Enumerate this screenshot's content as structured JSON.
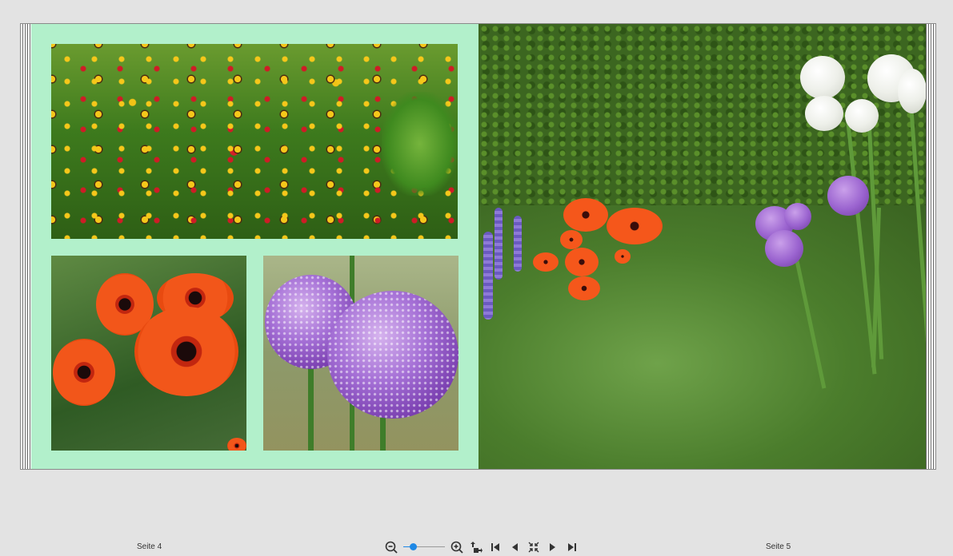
{
  "pages": {
    "left_label": "Seite 4",
    "right_label": "Seite 5"
  },
  "colors": {
    "page_background": "#b2f0cb",
    "app_background": "#e3e3e3",
    "accent": "#1e88e5"
  },
  "photos": {
    "left_top": "flower-meadow-photo",
    "left_bottom_left": "poppies-photo",
    "left_bottom_right": "allium-photo",
    "right_full": "garden-photo"
  },
  "toolbar": {
    "zoom_level_fraction": 0.18,
    "icons": [
      "zoom-out-icon",
      "zoom-in-icon",
      "fit-page-icon",
      "first-page-icon",
      "previous-page-icon",
      "fullscreen-icon",
      "next-page-icon",
      "last-page-icon"
    ]
  }
}
